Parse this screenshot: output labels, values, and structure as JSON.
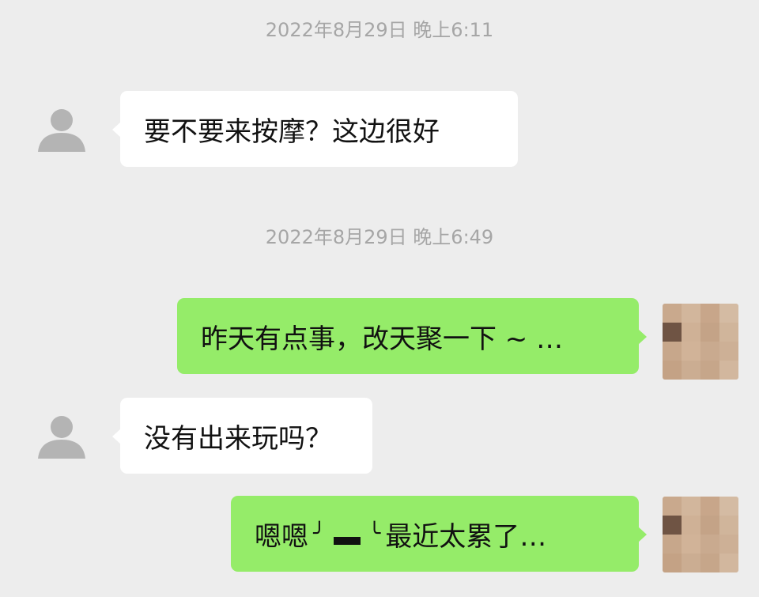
{
  "chat": {
    "timestamps": [
      "2022年8月29日 晚上6:11",
      "2022年8月29日 晚上6:49"
    ],
    "messages": [
      {
        "sender": "contact",
        "text": "要不要来按摩？这边很好"
      },
      {
        "sender": "me",
        "text": "昨天有点事，改天聚一下 ~ …"
      },
      {
        "sender": "contact",
        "text": "没有出来玩吗？"
      },
      {
        "sender": "me",
        "text_before": "嗯嗯",
        "emoji_left_glyph": "╯",
        "emoji_right_glyph": "╰",
        "text_after": "最近太累了…"
      }
    ]
  },
  "colors": {
    "background": "#ededed",
    "incoming_bubble": "#ffffff",
    "outgoing_bubble": "#95ec69",
    "timestamp_text": "#a6a6a6",
    "default_avatar": "#b4b4b4"
  },
  "icons": {
    "contact_avatar": "default-person-avatar-icon",
    "my_avatar": "pixelated-avatar-image"
  }
}
